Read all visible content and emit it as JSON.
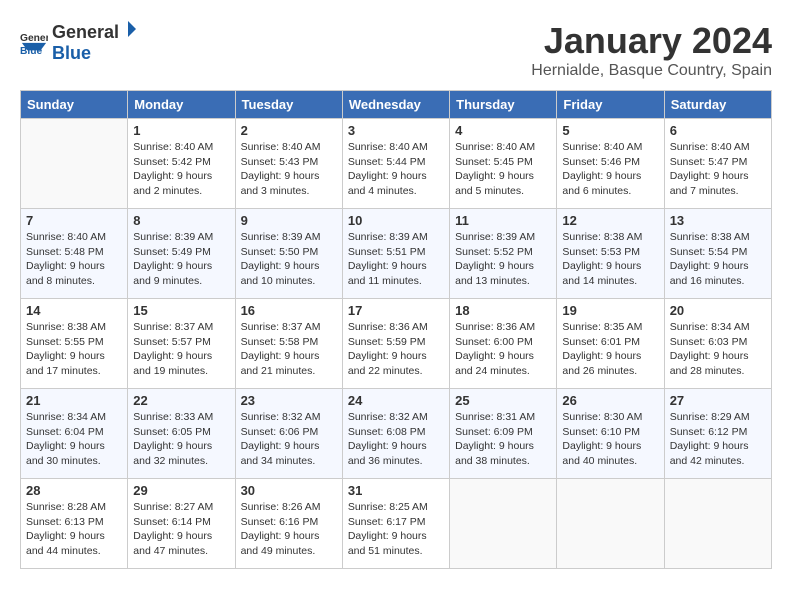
{
  "logo": {
    "text_general": "General",
    "text_blue": "Blue"
  },
  "title": "January 2024",
  "location": "Hernialde, Basque Country, Spain",
  "weekdays": [
    "Sunday",
    "Monday",
    "Tuesday",
    "Wednesday",
    "Thursday",
    "Friday",
    "Saturday"
  ],
  "weeks": [
    [
      {
        "day": "",
        "sunrise": "",
        "sunset": "",
        "daylight": ""
      },
      {
        "day": "1",
        "sunrise": "Sunrise: 8:40 AM",
        "sunset": "Sunset: 5:42 PM",
        "daylight": "Daylight: 9 hours and 2 minutes."
      },
      {
        "day": "2",
        "sunrise": "Sunrise: 8:40 AM",
        "sunset": "Sunset: 5:43 PM",
        "daylight": "Daylight: 9 hours and 3 minutes."
      },
      {
        "day": "3",
        "sunrise": "Sunrise: 8:40 AM",
        "sunset": "Sunset: 5:44 PM",
        "daylight": "Daylight: 9 hours and 4 minutes."
      },
      {
        "day": "4",
        "sunrise": "Sunrise: 8:40 AM",
        "sunset": "Sunset: 5:45 PM",
        "daylight": "Daylight: 9 hours and 5 minutes."
      },
      {
        "day": "5",
        "sunrise": "Sunrise: 8:40 AM",
        "sunset": "Sunset: 5:46 PM",
        "daylight": "Daylight: 9 hours and 6 minutes."
      },
      {
        "day": "6",
        "sunrise": "Sunrise: 8:40 AM",
        "sunset": "Sunset: 5:47 PM",
        "daylight": "Daylight: 9 hours and 7 minutes."
      }
    ],
    [
      {
        "day": "7",
        "sunrise": "Sunrise: 8:40 AM",
        "sunset": "Sunset: 5:48 PM",
        "daylight": "Daylight: 9 hours and 8 minutes."
      },
      {
        "day": "8",
        "sunrise": "Sunrise: 8:39 AM",
        "sunset": "Sunset: 5:49 PM",
        "daylight": "Daylight: 9 hours and 9 minutes."
      },
      {
        "day": "9",
        "sunrise": "Sunrise: 8:39 AM",
        "sunset": "Sunset: 5:50 PM",
        "daylight": "Daylight: 9 hours and 10 minutes."
      },
      {
        "day": "10",
        "sunrise": "Sunrise: 8:39 AM",
        "sunset": "Sunset: 5:51 PM",
        "daylight": "Daylight: 9 hours and 11 minutes."
      },
      {
        "day": "11",
        "sunrise": "Sunrise: 8:39 AM",
        "sunset": "Sunset: 5:52 PM",
        "daylight": "Daylight: 9 hours and 13 minutes."
      },
      {
        "day": "12",
        "sunrise": "Sunrise: 8:38 AM",
        "sunset": "Sunset: 5:53 PM",
        "daylight": "Daylight: 9 hours and 14 minutes."
      },
      {
        "day": "13",
        "sunrise": "Sunrise: 8:38 AM",
        "sunset": "Sunset: 5:54 PM",
        "daylight": "Daylight: 9 hours and 16 minutes."
      }
    ],
    [
      {
        "day": "14",
        "sunrise": "Sunrise: 8:38 AM",
        "sunset": "Sunset: 5:55 PM",
        "daylight": "Daylight: 9 hours and 17 minutes."
      },
      {
        "day": "15",
        "sunrise": "Sunrise: 8:37 AM",
        "sunset": "Sunset: 5:57 PM",
        "daylight": "Daylight: 9 hours and 19 minutes."
      },
      {
        "day": "16",
        "sunrise": "Sunrise: 8:37 AM",
        "sunset": "Sunset: 5:58 PM",
        "daylight": "Daylight: 9 hours and 21 minutes."
      },
      {
        "day": "17",
        "sunrise": "Sunrise: 8:36 AM",
        "sunset": "Sunset: 5:59 PM",
        "daylight": "Daylight: 9 hours and 22 minutes."
      },
      {
        "day": "18",
        "sunrise": "Sunrise: 8:36 AM",
        "sunset": "Sunset: 6:00 PM",
        "daylight": "Daylight: 9 hours and 24 minutes."
      },
      {
        "day": "19",
        "sunrise": "Sunrise: 8:35 AM",
        "sunset": "Sunset: 6:01 PM",
        "daylight": "Daylight: 9 hours and 26 minutes."
      },
      {
        "day": "20",
        "sunrise": "Sunrise: 8:34 AM",
        "sunset": "Sunset: 6:03 PM",
        "daylight": "Daylight: 9 hours and 28 minutes."
      }
    ],
    [
      {
        "day": "21",
        "sunrise": "Sunrise: 8:34 AM",
        "sunset": "Sunset: 6:04 PM",
        "daylight": "Daylight: 9 hours and 30 minutes."
      },
      {
        "day": "22",
        "sunrise": "Sunrise: 8:33 AM",
        "sunset": "Sunset: 6:05 PM",
        "daylight": "Daylight: 9 hours and 32 minutes."
      },
      {
        "day": "23",
        "sunrise": "Sunrise: 8:32 AM",
        "sunset": "Sunset: 6:06 PM",
        "daylight": "Daylight: 9 hours and 34 minutes."
      },
      {
        "day": "24",
        "sunrise": "Sunrise: 8:32 AM",
        "sunset": "Sunset: 6:08 PM",
        "daylight": "Daylight: 9 hours and 36 minutes."
      },
      {
        "day": "25",
        "sunrise": "Sunrise: 8:31 AM",
        "sunset": "Sunset: 6:09 PM",
        "daylight": "Daylight: 9 hours and 38 minutes."
      },
      {
        "day": "26",
        "sunrise": "Sunrise: 8:30 AM",
        "sunset": "Sunset: 6:10 PM",
        "daylight": "Daylight: 9 hours and 40 minutes."
      },
      {
        "day": "27",
        "sunrise": "Sunrise: 8:29 AM",
        "sunset": "Sunset: 6:12 PM",
        "daylight": "Daylight: 9 hours and 42 minutes."
      }
    ],
    [
      {
        "day": "28",
        "sunrise": "Sunrise: 8:28 AM",
        "sunset": "Sunset: 6:13 PM",
        "daylight": "Daylight: 9 hours and 44 minutes."
      },
      {
        "day": "29",
        "sunrise": "Sunrise: 8:27 AM",
        "sunset": "Sunset: 6:14 PM",
        "daylight": "Daylight: 9 hours and 47 minutes."
      },
      {
        "day": "30",
        "sunrise": "Sunrise: 8:26 AM",
        "sunset": "Sunset: 6:16 PM",
        "daylight": "Daylight: 9 hours and 49 minutes."
      },
      {
        "day": "31",
        "sunrise": "Sunrise: 8:25 AM",
        "sunset": "Sunset: 6:17 PM",
        "daylight": "Daylight: 9 hours and 51 minutes."
      },
      {
        "day": "",
        "sunrise": "",
        "sunset": "",
        "daylight": ""
      },
      {
        "day": "",
        "sunrise": "",
        "sunset": "",
        "daylight": ""
      },
      {
        "day": "",
        "sunrise": "",
        "sunset": "",
        "daylight": ""
      }
    ]
  ]
}
